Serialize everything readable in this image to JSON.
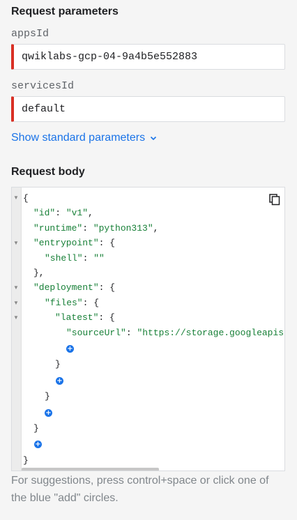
{
  "request_parameters": {
    "title": "Request parameters",
    "fields": [
      {
        "label": "appsId",
        "value": "qwiklabs-gcp-04-9a4b5e552883"
      },
      {
        "label": "servicesId",
        "value": "default"
      }
    ],
    "show_standard": "Show standard parameters"
  },
  "request_body": {
    "title": "Request body",
    "code": {
      "open_root": "{",
      "id_key": "\"id\"",
      "id_val": "\"v1\"",
      "runtime_key": "\"runtime\"",
      "runtime_val": "\"python313\"",
      "entrypoint_key": "\"entrypoint\"",
      "shell_key": "\"shell\"",
      "shell_val": "\"\"",
      "deployment_key": "\"deployment\"",
      "files_key": "\"files\"",
      "latest_key": "\"latest\"",
      "sourceurl_key": "\"sourceUrl\"",
      "sourceurl_val": "\"https://storage.googleapis.",
      "close_root": "}"
    }
  },
  "hint": "For suggestions, press control+space or click one of the blue \"add\" circles.",
  "colors": {
    "accent": "#1a73e8",
    "error_border": "#d93025",
    "json_string": "#188038"
  },
  "icons": [
    "chevron-down-icon",
    "copy-icon",
    "fold-arrow-icon",
    "add-circle-icon"
  ]
}
